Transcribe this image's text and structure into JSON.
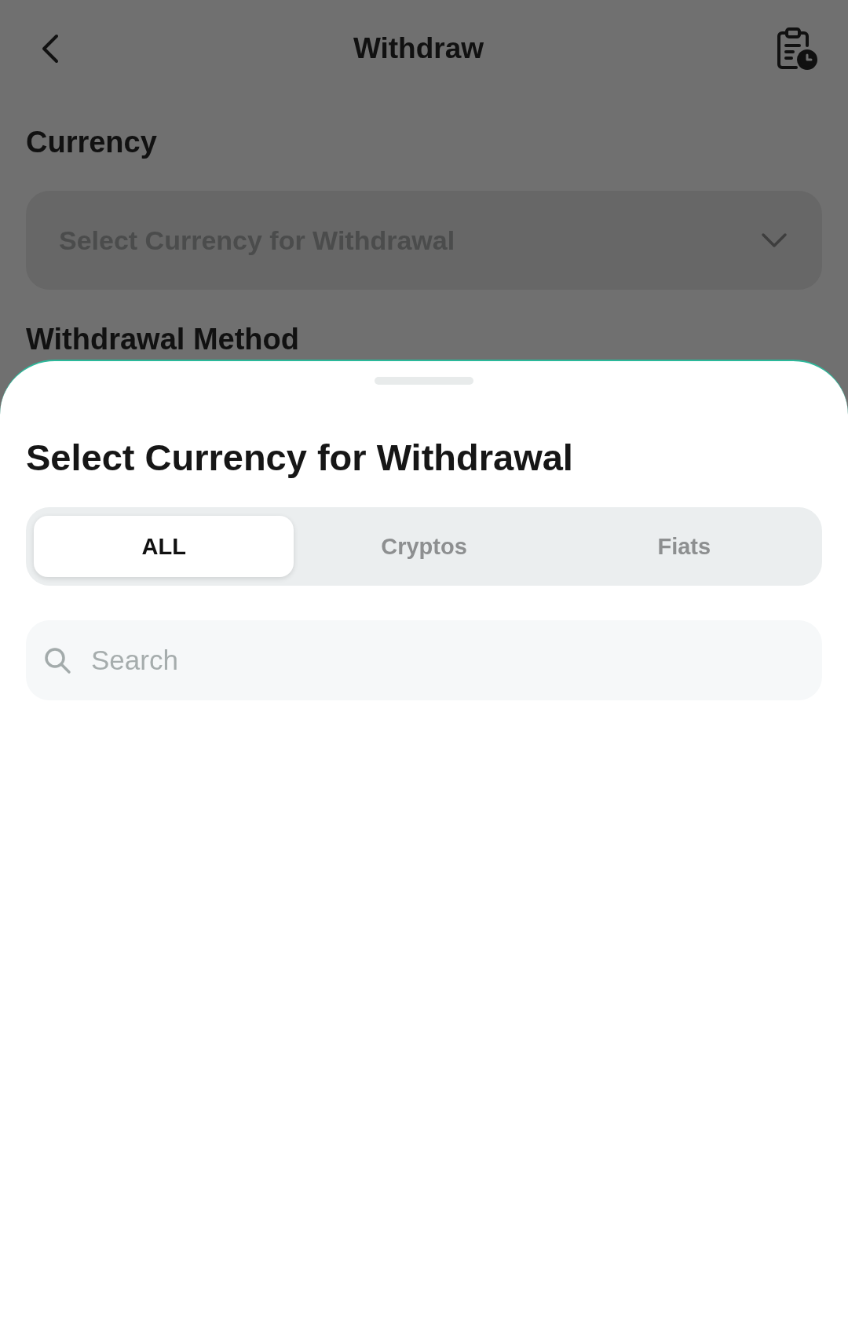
{
  "header": {
    "title": "Withdraw"
  },
  "currency": {
    "label": "Currency",
    "dropdown": {
      "placeholder": "Select Currency for Withdrawal"
    }
  },
  "withdrawal_method": {
    "label": "Withdrawal Method"
  },
  "sheet": {
    "title": "Select Currency for Withdrawal",
    "tabs": [
      {
        "label": "ALL",
        "selected": true
      },
      {
        "label": "Cryptos",
        "selected": false
      },
      {
        "label": "Fiats",
        "selected": false
      }
    ],
    "search": {
      "placeholder": "Search"
    }
  }
}
